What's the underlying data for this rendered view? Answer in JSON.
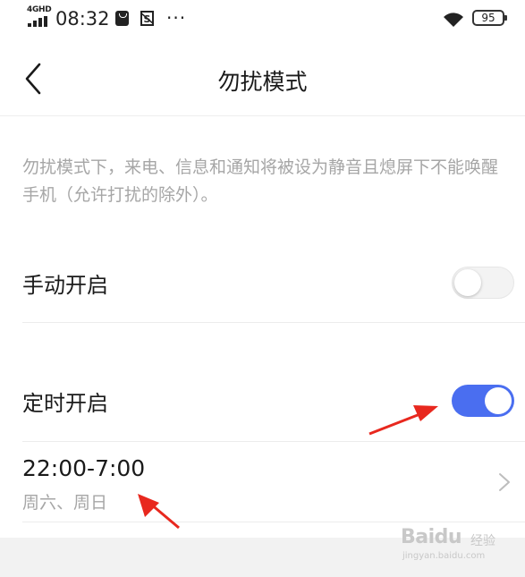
{
  "status_bar": {
    "network": "4GHD",
    "time": "08:32",
    "more": "···",
    "battery": "95"
  },
  "header": {
    "title": "勿扰模式"
  },
  "description": "勿扰模式下，来电、信息和通知将被设为静音且熄屏下不能唤醒手机（允许打扰的除外）。",
  "manual": {
    "label": "手动开启",
    "enabled": false
  },
  "scheduled": {
    "label": "定时开启",
    "enabled": true,
    "time_range": "22:00-7:00",
    "days": "周六、周日"
  },
  "colors": {
    "accent": "#4a6ef0",
    "annotation": "#e8281e",
    "secondary_text": "#a6a6a6"
  },
  "watermark": {
    "brand": "Baidu",
    "brand_cn": "经验",
    "url": "jingyan.baidu.com"
  }
}
